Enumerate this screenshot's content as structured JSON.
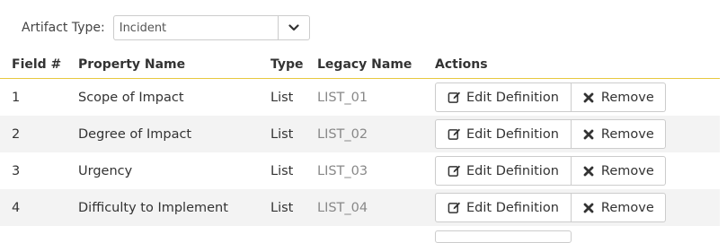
{
  "filter": {
    "label": "Artifact Type:",
    "selected": "Incident"
  },
  "table": {
    "headers": [
      "Field #",
      "Property Name",
      "Type",
      "Legacy Name",
      "Actions"
    ],
    "edit_label": "Edit Definition",
    "remove_label": "Remove",
    "rows": [
      {
        "field": "1",
        "name": "Scope of Impact",
        "type": "List",
        "legacy": "LIST_01"
      },
      {
        "field": "2",
        "name": "Degree of Impact",
        "type": "List",
        "legacy": "LIST_02"
      },
      {
        "field": "3",
        "name": "Urgency",
        "type": "List",
        "legacy": "LIST_03"
      },
      {
        "field": "4",
        "name": "Difficulty to Implement",
        "type": "List",
        "legacy": "LIST_04"
      }
    ]
  },
  "colors": {
    "header_rule": "#e8c840",
    "zebra": "#f3f3f3",
    "legacy_text": "#888888"
  },
  "icons": {
    "dropdown": "chevron-down-icon",
    "edit": "edit-icon",
    "remove": "close-icon"
  }
}
